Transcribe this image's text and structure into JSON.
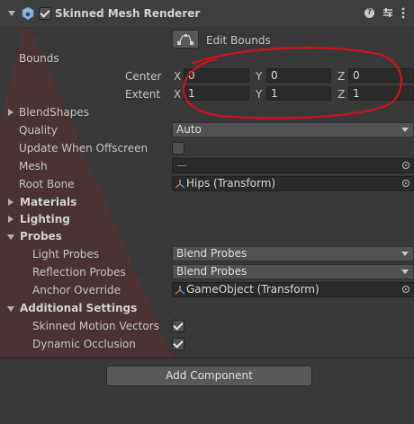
{
  "component": {
    "title": "Skinned Mesh Renderer",
    "icons": [
      "renderer-icon",
      "help-icon",
      "preset-icon",
      "overflow-menu-icon"
    ]
  },
  "edit_bounds": {
    "label": "Edit Bounds",
    "icon": "edit-bounds-icon"
  },
  "bounds": {
    "label": "Bounds",
    "center": {
      "label": "Center",
      "x_label": "X",
      "x": "0",
      "y_label": "Y",
      "y": "0",
      "z_label": "Z",
      "z": "0"
    },
    "extent": {
      "label": "Extent",
      "x_label": "X",
      "x": "1",
      "y_label": "Y",
      "y": "1",
      "z_label": "Z",
      "z": "1"
    }
  },
  "blendshapes": {
    "label": "BlendShapes"
  },
  "quality": {
    "label": "Quality",
    "value": "Auto"
  },
  "update_offscreen": {
    "label": "Update When Offscreen",
    "checked": false
  },
  "mesh": {
    "label": "Mesh",
    "value": "—"
  },
  "root_bone": {
    "label": "Root Bone",
    "value": "Hips (Transform)"
  },
  "sections": {
    "materials": "Materials",
    "lighting": "Lighting",
    "probes": "Probes",
    "additional": "Additional Settings"
  },
  "probes": {
    "light": {
      "label": "Light Probes",
      "value": "Blend Probes"
    },
    "reflection": {
      "label": "Reflection Probes",
      "value": "Blend Probes"
    },
    "anchor": {
      "label": "Anchor Override",
      "value": "GameObject (Transform)"
    }
  },
  "additional": {
    "motion_vectors": {
      "label": "Skinned Motion Vectors",
      "checked": true
    },
    "dynamic_occlusion": {
      "label": "Dynamic Occlusion",
      "checked": true
    }
  },
  "add_component": {
    "label": "Add Component"
  },
  "annotation_color": "#d0101a"
}
